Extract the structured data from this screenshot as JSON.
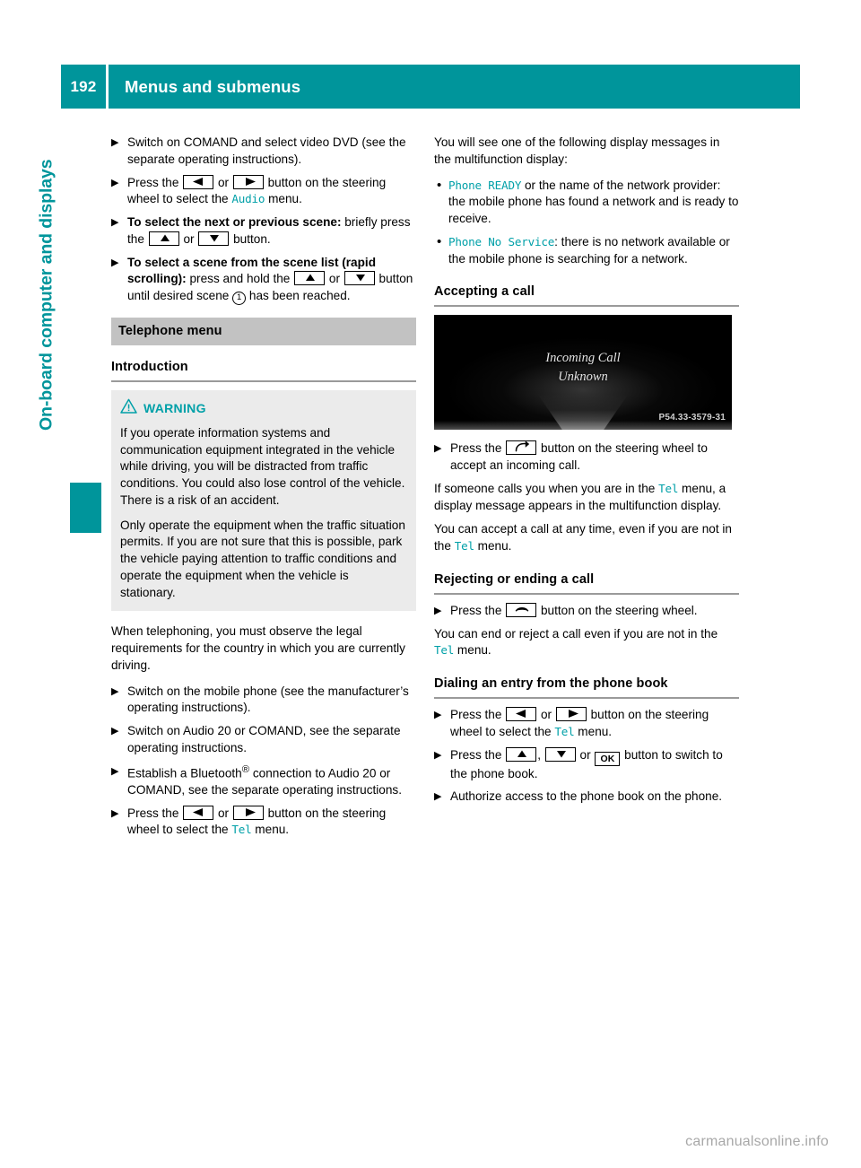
{
  "header": {
    "page_number": "192",
    "title": "Menus and submenus"
  },
  "sidebar": {
    "chapter_label": "On-board computer and displays"
  },
  "icons": {
    "left_button": "left-arrow-button",
    "right_button": "right-arrow-button",
    "up_button": "up-arrow-button",
    "down_button": "down-arrow-button",
    "ok_button_label": "OK",
    "accept_call_button": "phone-handset-accept-icon",
    "end_call_button": "phone-handset-end-icon",
    "callout_one": "1",
    "warning_icon": "warning-triangle-icon"
  },
  "colors": {
    "accent_teal": "#00959b",
    "mono_teal": "#00a0a8",
    "section_bar_grey": "#c2c2c2",
    "warning_box_grey": "#ebebeb",
    "rule_grey": "#9a9a9a"
  },
  "left_column": {
    "steps_video": [
      {
        "text_1": "Switch on COMAND and select video DVD (see the separate operating instructions)."
      },
      {
        "text_1": "Press the ",
        "text_2": " or ",
        "text_3": " button on the steering wheel to select the ",
        "mono_1": "Audio",
        "text_4": " menu."
      },
      {
        "bold_1": "To select the next or previous scene:",
        "text_1": " briefly press the ",
        "text_2": " or ",
        "text_3": " button."
      },
      {
        "bold_1": "To select a scene from the scene list (rapid scrolling):",
        "text_1": " press and hold the ",
        "text_2": " or ",
        "text_3": " button until desired scene ",
        "text_4": " has been reached."
      }
    ],
    "section_bar": "Telephone menu",
    "introduction_heading": "Introduction",
    "warning": {
      "title": "WARNING",
      "paragraph_1": "If you operate information systems and communication equipment integrated in the vehicle while driving, you will be distracted from traffic conditions. You could also lose control of the vehicle. There is a risk of an accident.",
      "paragraph_2": "Only operate the equipment when the traffic situation permits. If you are not sure that this is possible, park the vehicle paying attention to traffic conditions and operate the equipment when the vehicle is stationary."
    },
    "telephoning_paragraph": "When telephoning, you must observe the legal requirements for the country in which you are currently driving.",
    "steps_phone": [
      {
        "text_1": "Switch on the mobile phone (see the manufacturer’s operating instructions)."
      },
      {
        "text_1": "Switch on Audio 20 or COMAND, see the separate operating instructions."
      },
      {
        "text_1": "Establish a Bluetooth",
        "sup_1": "®",
        "text_2": " connection to Audio 20 or COMAND, see the separate operating instructions."
      },
      {
        "text_1": "Press the ",
        "text_2": " or ",
        "text_3": " button on the steering wheel to select the ",
        "mono_1": "Tel",
        "text_4": " menu."
      }
    ]
  },
  "right_column": {
    "intro_paragraph": "You will see one of the following display messages in the multifunction display:",
    "bullets": [
      {
        "mono_1": "Phone READY",
        "text_1": " or the name of the network provider: the mobile phone has found a network and is ready to receive."
      },
      {
        "mono_1": "Phone No Service",
        "text_1": ": there is no network available or the mobile phone is searching for a network."
      }
    ],
    "accepting_heading": "Accepting a call",
    "figure": {
      "line_1": "Incoming Call",
      "line_2": "Unknown",
      "code": "P54.33-3579-31"
    },
    "accept_step": {
      "text_1": "Press the ",
      "text_2": " button on the steering wheel to accept an incoming call."
    },
    "accept_paragraph_1_a": "If someone calls you when you are in the ",
    "accept_paragraph_1_mono": "Tel",
    "accept_paragraph_1_b": " menu, a display message appears in the multifunction display.",
    "accept_paragraph_2_a": "You can accept a call at any time, even if you are not in the ",
    "accept_paragraph_2_mono": "Tel",
    "accept_paragraph_2_b": " menu.",
    "rejecting_heading": "Rejecting or ending a call",
    "reject_step": {
      "text_1": "Press the ",
      "text_2": " button on the steering wheel."
    },
    "reject_paragraph_a": "You can end or reject a call even if you are not in the ",
    "reject_paragraph_mono": "Tel",
    "reject_paragraph_b": " menu.",
    "dialing_heading": "Dialing an entry from the phone book",
    "dialing_steps": [
      {
        "text_1": "Press the ",
        "text_2": " or ",
        "text_3": " button on the steering wheel to select the ",
        "mono_1": "Tel",
        "text_4": " menu."
      },
      {
        "text_1": "Press the ",
        "text_2": ", ",
        "text_3": " or ",
        "text_4": " button to switch to the phone book."
      },
      {
        "text_1": "Authorize access to the phone book on the phone."
      }
    ]
  },
  "footer": {
    "watermark": "carmanualsonline.info"
  }
}
